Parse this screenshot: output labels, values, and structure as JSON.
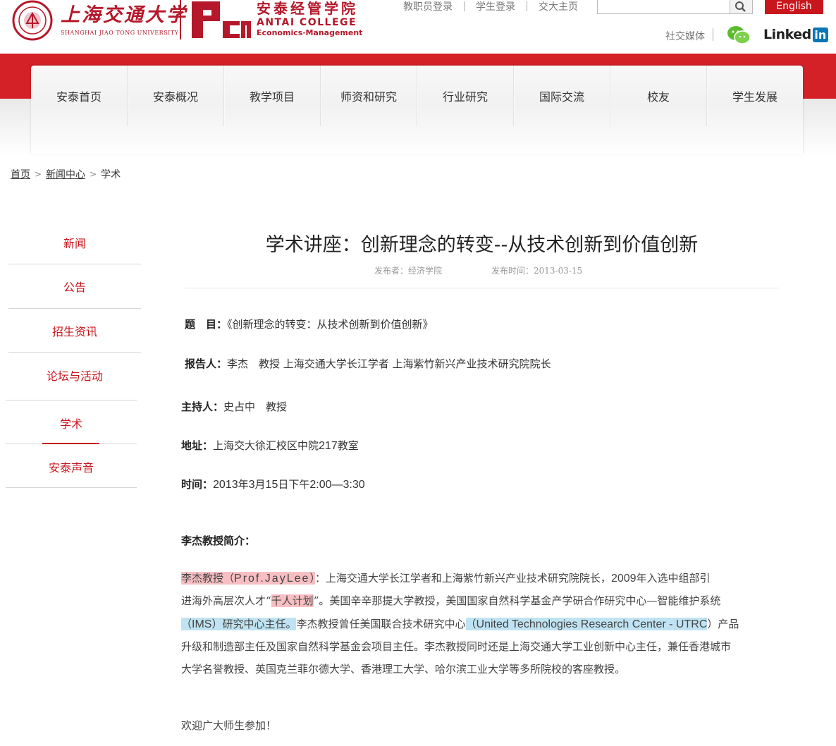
{
  "header": {
    "university_cn": "上海交通大学",
    "university_en": "Shanghai Jiao Tong University",
    "college_cn": "安泰经管学院",
    "college_en": "ANTAI COLLEGE",
    "college_sub": "Economics·Management",
    "acem_mark": "ACEM",
    "top_links": [
      "教职员登录",
      "学生登录",
      "交大主页"
    ],
    "search_placeholder": "",
    "english_label": "English",
    "social_label": "社交媒体",
    "linkedin_label": "Linked",
    "linkedin_box": "in",
    "brand_red": "#c8161d"
  },
  "nav": {
    "items": [
      "安泰首页",
      "安泰概况",
      "教学项目",
      "师资和研究",
      "行业研究",
      "国际交流",
      "校友",
      "学生发展"
    ]
  },
  "breadcrumb": {
    "home": "首页",
    "news": "新闻中心",
    "current": "学术",
    "separator": ">"
  },
  "sidebar": {
    "items": [
      "新闻",
      "公告",
      "招生资讯",
      "论坛与活动",
      "学术",
      "安泰声音"
    ],
    "active": "学术"
  },
  "article": {
    "title": "学术讲座：创新理念的转变--从技术创新到价值创新",
    "publisher": "发布者：经济学院",
    "publish_time": "发布时间：2013-03-15",
    "topic_label": "题　目：",
    "topic_value": "《创新理念的转变：从技术创新到价值创新》",
    "speaker_label": "报告人：",
    "speaker_value": "李杰　教授 上海交通大学长江学者 上海紫竹新兴产业技术研究院院长",
    "host_label": "主持人：",
    "host_value": "史占中　教授",
    "location_label": "地址：",
    "location_value_a": "上海交大徐汇校区中院",
    "location_value_b": "217",
    "location_value_c": "教室",
    "time_label": "时间：",
    "time_value_a": "2013",
    "time_value_b": "年",
    "time_value_c": "3",
    "time_value_d": "月",
    "time_value_e": "15",
    "time_value_f": "日下午",
    "time_value_g": "2:00—3:30",
    "bio_heading": "李杰教授简介：",
    "bio": {
      "l1_hl_a": "李杰教授（",
      "l1_hl_b": "Prof.JayLee",
      "l1_hl_c": "）",
      "l1_rest_a": "：上海交通大学长江学者和上海紫竹新兴产业技术研究院院长，",
      "l1_rest_b": "2009",
      "l1_rest_c": "年入选中组部引",
      "l2_a": "进海外高层次人才“",
      "l2_hl": "千人计划",
      "l2_b": "”。美国辛辛那提大学教授，美国国家自然科学基金产学研合作研究中心—智能维护系统",
      "l3_hl_a": "（",
      "l3_hl_b": "IMS",
      "l3_hl_c": "）研究中心主任。",
      "l3_mid": "李杰教授曾任美国联合技术研究中心",
      "l3_hl2_a": "（",
      "l3_hl2_b": "United Technologies Research Center - UTRC",
      "l3_end": "）产品",
      "l4": "升级和制造部主任及国家自然科学基金会项目主任。李杰教授同时还是上海交通大学工业创新中心主任，兼任香港城市",
      "l5": "大学名誉教授、英国克兰菲尔德大学、香港理工大学、哈尔滨工业大学等多所院校的客座教授。"
    },
    "closing": "欢迎广大师生参加！"
  }
}
